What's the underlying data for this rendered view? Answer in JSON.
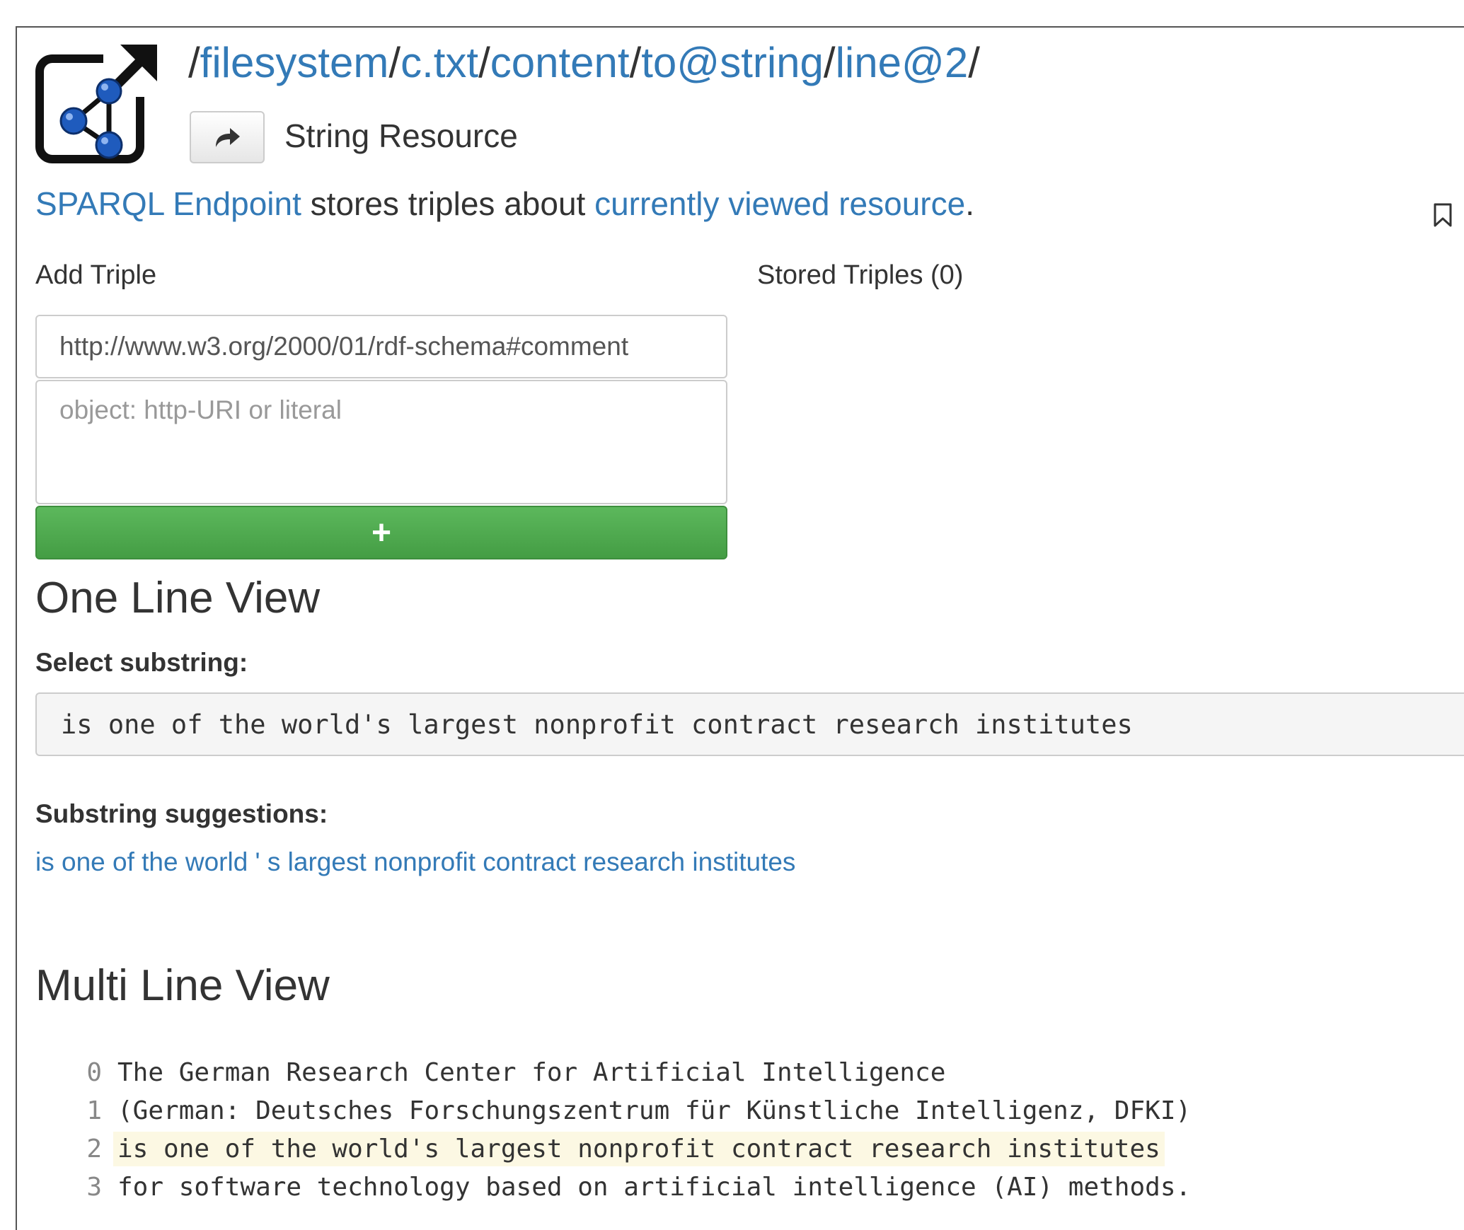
{
  "header": {
    "breadcrumb": [
      {
        "sep": "/",
        "label": "filesystem"
      },
      {
        "sep": "/",
        "label": "c.txt"
      },
      {
        "sep": "/",
        "label": "content"
      },
      {
        "sep": "/",
        "label": "to@string"
      },
      {
        "sep": "/",
        "label": "line@2"
      }
    ],
    "breadcrumb_trailing_sep": "/",
    "resource_type": "String Resource",
    "share_icon": "share-arrow-icon"
  },
  "endpoint": {
    "link_label": "SPARQL Endpoint",
    "middle_text": " stores triples about ",
    "resource_link": "currently viewed resource",
    "end": "."
  },
  "triples": {
    "add_label": "Add Triple",
    "stored_label": "Stored Triples (0)",
    "predicate_value": "http://www.w3.org/2000/01/rdf-schema#comment",
    "object_placeholder": "object: http-URI or literal",
    "add_button_label": "+"
  },
  "one_line_view": {
    "heading": "One Line View",
    "select_label": "Select substring:",
    "substring": "is one of the world's largest nonprofit contract research institutes",
    "suggestions_label": "Substring suggestions:",
    "suggestion": "is one of the world ' s largest nonprofit contract research institutes"
  },
  "multi_line_view": {
    "heading": "Multi Line View",
    "lines": [
      {
        "num": "0",
        "text": "The German Research Center for Artificial Intelligence"
      },
      {
        "num": "1",
        "text": "(German: Deutsches Forschungszentrum für Künstliche Intelligenz, DFKI)"
      },
      {
        "num": "2",
        "text": "is one of the world's largest nonprofit contract research institutes",
        "highlighted": true
      },
      {
        "num": "3",
        "text": "for software technology based on artificial intelligence (AI) methods."
      }
    ]
  },
  "colors": {
    "link": "#337ab7",
    "success_button": "#5cb85c",
    "highlight": "#fcf8e3"
  }
}
